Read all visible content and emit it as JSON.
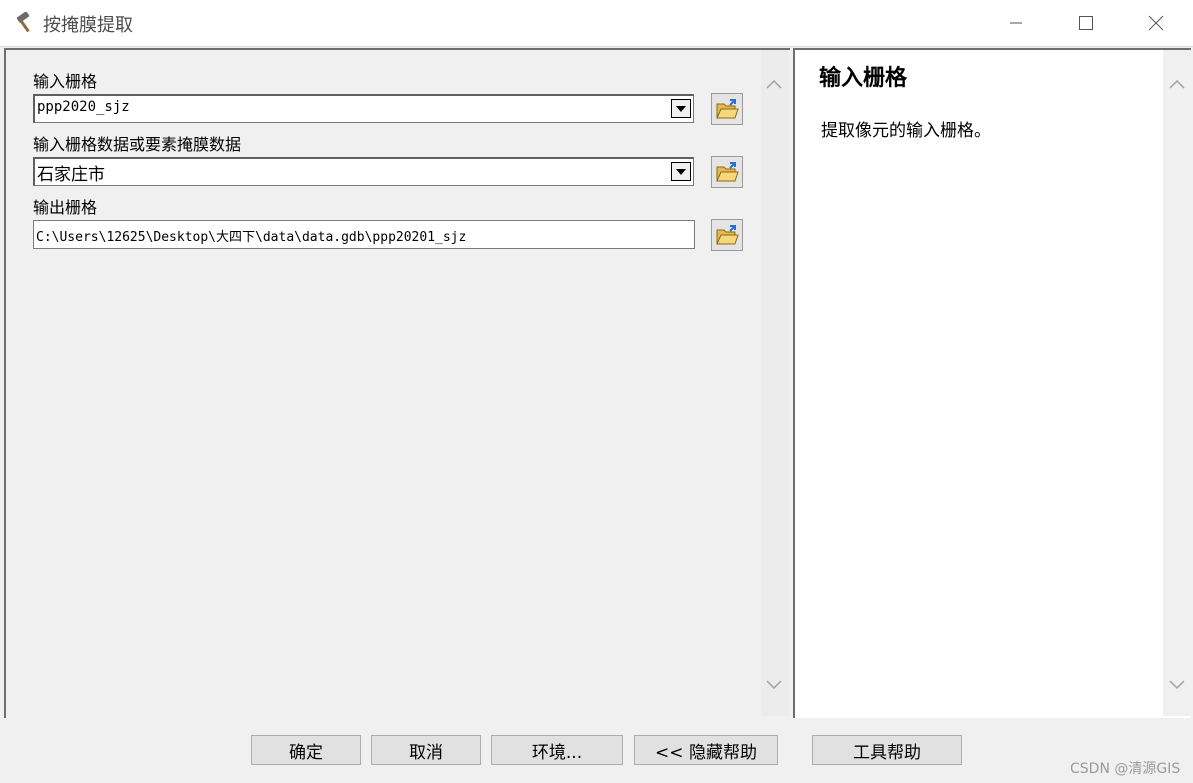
{
  "window": {
    "title": "按掩膜提取",
    "icons": {
      "app": "hammer-icon",
      "minimize": "minimize-icon",
      "maximize": "maximize-icon",
      "close": "close-icon"
    }
  },
  "form": {
    "fields": [
      {
        "label": "输入栅格",
        "value": "ppp2020_sjz",
        "type": "combo"
      },
      {
        "label": "输入栅格数据或要素掩膜数据",
        "value": "石家庄市",
        "type": "combo"
      },
      {
        "label": "输出栅格",
        "value": "C:\\Users\\12625\\Desktop\\大四下\\data\\data.gdb\\ppp20201_sjz",
        "type": "text"
      }
    ]
  },
  "help": {
    "title": "输入栅格",
    "description": "提取像元的输入栅格。"
  },
  "buttons": {
    "ok": "确定",
    "cancel": "取消",
    "environments": "环境...",
    "hide_help": "<< 隐藏帮助",
    "tool_help": "工具帮助"
  },
  "watermark": "CSDN @清源GIS"
}
